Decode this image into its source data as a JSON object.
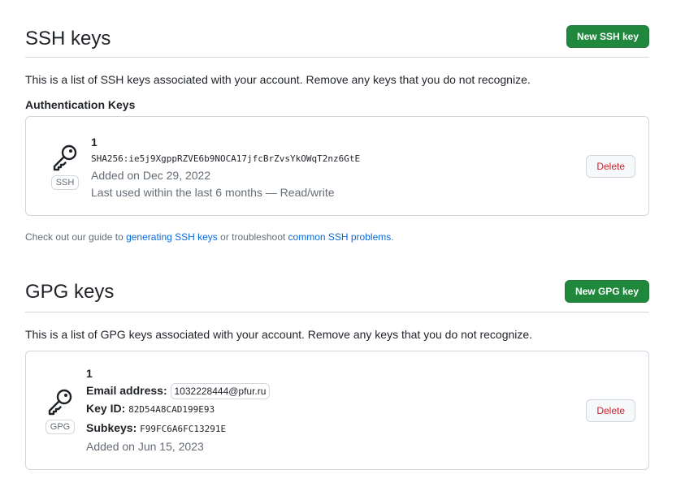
{
  "ssh": {
    "title": "SSH keys",
    "new_button": "New SSH key",
    "intro": "This is a list of SSH keys associated with your account. Remove any keys that you do not recognize.",
    "subheading": "Authentication Keys",
    "key": {
      "type_label": "SSH",
      "title": "1",
      "fingerprint": "SHA256:ie5j9XgppRZVE6b9NOCA17jfcBrZvsYkOWqT2nz6GtE",
      "added": "Added on Dec 29, 2022",
      "last_used": "Last used within the last 6 months — Read/write",
      "delete_label": "Delete"
    },
    "note": {
      "prefix": "Check out our guide to ",
      "link1": "generating SSH keys",
      "middle": " or troubleshoot ",
      "link2": "common SSH problems",
      "suffix": "."
    }
  },
  "gpg": {
    "title": "GPG keys",
    "new_button": "New GPG key",
    "intro": "This is a list of GPG keys associated with your account. Remove any keys that you do not recognize.",
    "key": {
      "type_label": "GPG",
      "title": "1",
      "email_label": "Email address:",
      "email_value": "1032228444@pfur.ru",
      "keyid_label": "Key ID:",
      "keyid_value": "82D54A8CAD199E93",
      "subkeys_label": "Subkeys:",
      "subkeys_value": "F99FC6A6FC13291E",
      "added": "Added on Jun 15, 2023",
      "delete_label": "Delete"
    }
  },
  "icons": {
    "key": "key-icon"
  },
  "colors": {
    "primary": "#1f883d",
    "danger": "#cf222e",
    "link": "#0969da",
    "border": "#d0d7de"
  }
}
